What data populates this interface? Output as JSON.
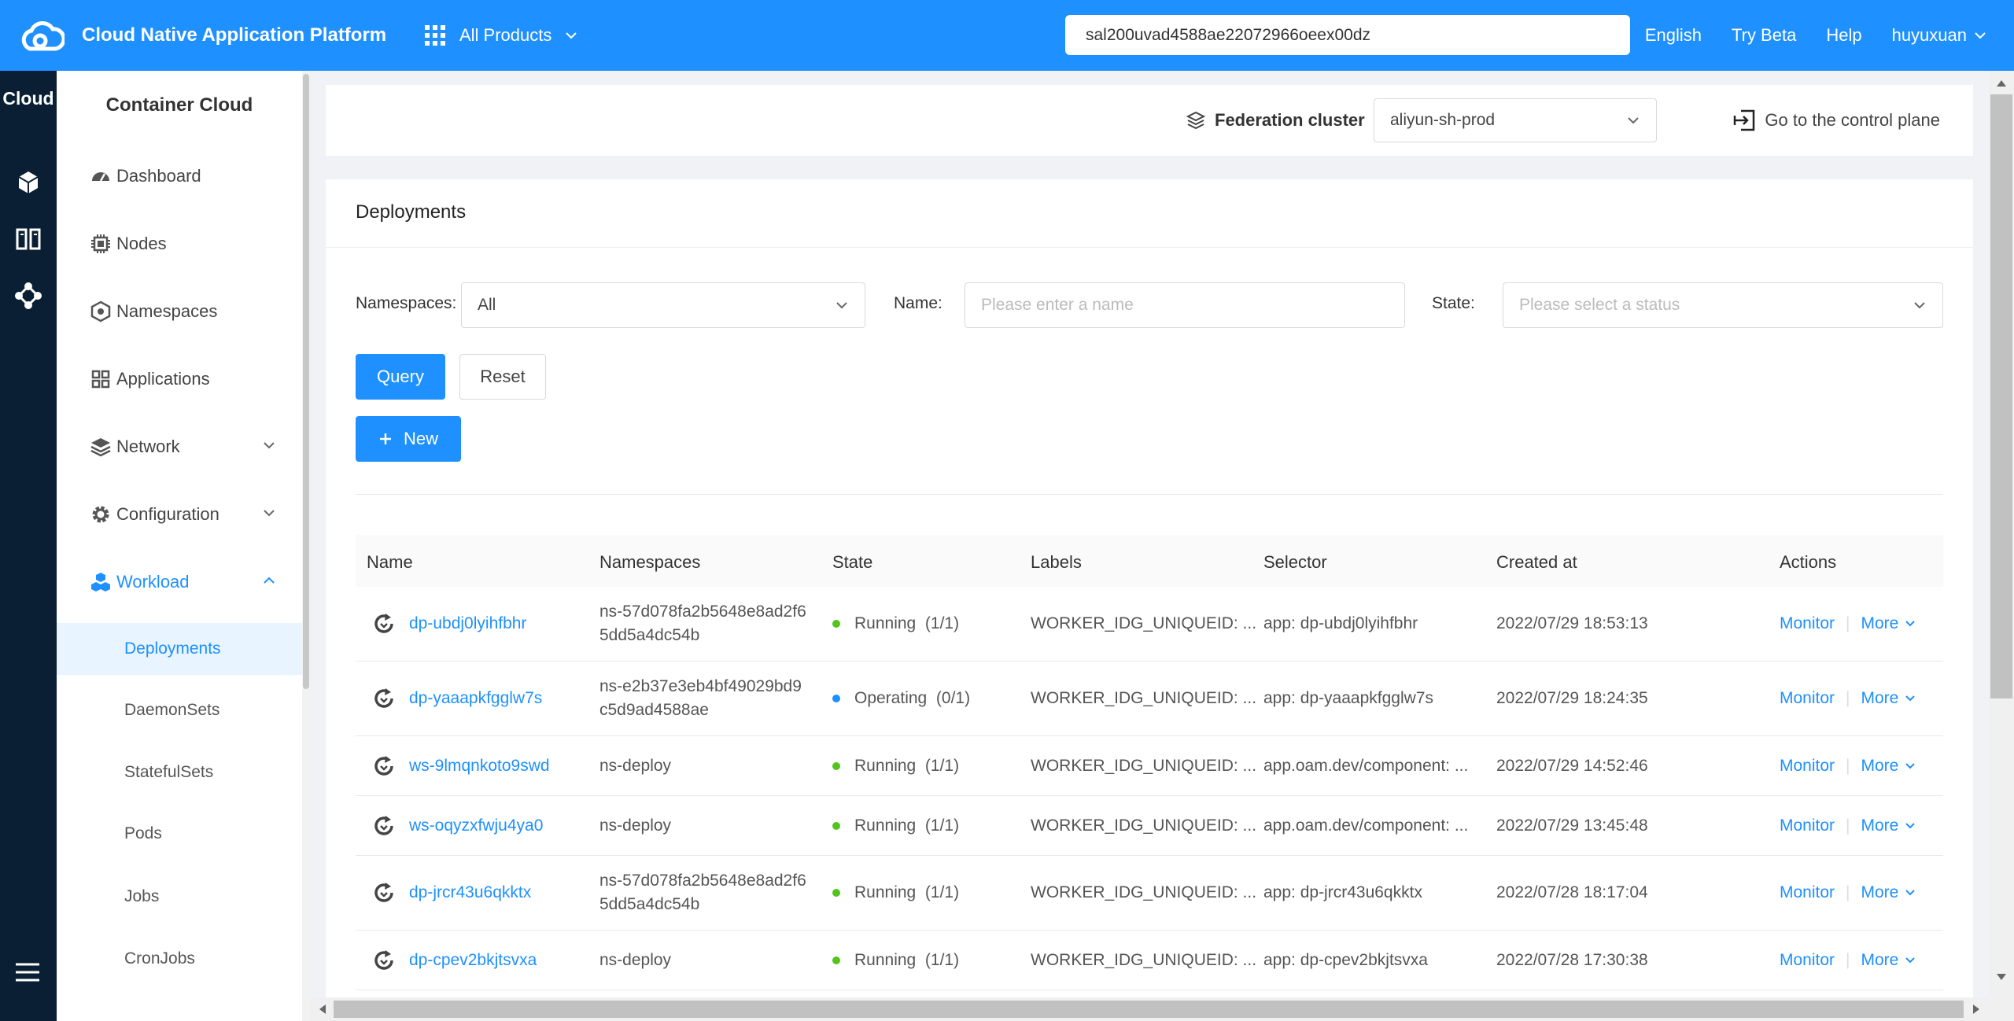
{
  "topbar": {
    "brand": "Cloud Native Application Platform",
    "products_label": "All Products",
    "search_value": "sal200uvad4588ae22072966oeex00dz",
    "language": "English",
    "try_beta": "Try Beta",
    "help": "Help",
    "user": "huyuxuan"
  },
  "rail": {
    "title": "Cloud"
  },
  "sidebar": {
    "title": "Container Cloud",
    "items": [
      {
        "label": "Dashboard",
        "icon": "dashboard-icon"
      },
      {
        "label": "Nodes",
        "icon": "chip-icon"
      },
      {
        "label": "Namespaces",
        "icon": "hexagon-icon"
      },
      {
        "label": "Applications",
        "icon": "apps-grid-icon"
      },
      {
        "label": "Network",
        "icon": "layers-icon"
      },
      {
        "label": "Configuration",
        "icon": "gear-icon"
      },
      {
        "label": "Workload",
        "icon": "cubes-icon"
      }
    ],
    "subitems": [
      "Deployments",
      "DaemonSets",
      "StatefulSets",
      "Pods",
      "Jobs",
      "CronJobs"
    ]
  },
  "federation": {
    "label": "Federation cluster",
    "selected": "aliyun-sh-prod",
    "goto_label": "Go to the control plane"
  },
  "deployments": {
    "title": "Deployments",
    "filters": {
      "namespaces_label": "Namespaces:",
      "namespaces_value": "All",
      "name_label": "Name:",
      "name_placeholder": "Please enter a name",
      "state_label": "State:",
      "state_placeholder": "Please select a status"
    },
    "query_label": "Query",
    "reset_label": "Reset",
    "new_label": "New",
    "columns": [
      "Name",
      "Namespaces",
      "State",
      "Labels",
      "Selector",
      "Created at",
      "Actions"
    ],
    "rows": [
      {
        "name": "dp-ubdj0lyihfbhr",
        "ns1": "ns-57d078fa2b5648e8ad2f6",
        "ns2": "5dd5a4dc54b",
        "state": "Running",
        "count": "(1/1)",
        "labels": "WORKER_IDG_UNIQUEID: ...",
        "selector": "app: dp-ubdj0lyihfbhr",
        "created": "2022/07/29 18:53:13",
        "monitor": "Monitor",
        "more": "More"
      },
      {
        "name": "dp-yaaapkfgglw7s",
        "ns1": "ns-e2b37e3eb4bf49029bd9",
        "ns2": "c5d9ad4588ae",
        "state": "Operating",
        "count": "(0/1)",
        "labels": "WORKER_IDG_UNIQUEID: ...",
        "selector": "app: dp-yaaapkfgglw7s",
        "created": "2022/07/29 18:24:35",
        "monitor": "Monitor",
        "more": "More"
      },
      {
        "name": "ws-9lmqnkoto9swd",
        "ns1": "ns-deploy",
        "ns2": "",
        "state": "Running",
        "count": "(1/1)",
        "labels": "WORKER_IDG_UNIQUEID: ...",
        "selector": "app.oam.dev/component: ...",
        "created": "2022/07/29 14:52:46",
        "monitor": "Monitor",
        "more": "More"
      },
      {
        "name": "ws-oqyzxfwju4ya0",
        "ns1": "ns-deploy",
        "ns2": "",
        "state": "Running",
        "count": "(1/1)",
        "labels": "WORKER_IDG_UNIQUEID: ...",
        "selector": "app.oam.dev/component: ...",
        "created": "2022/07/29 13:45:48",
        "monitor": "Monitor",
        "more": "More"
      },
      {
        "name": "dp-jrcr43u6qkktx",
        "ns1": "ns-57d078fa2b5648e8ad2f6",
        "ns2": "5dd5a4dc54b",
        "state": "Running",
        "count": "(1/1)",
        "labels": "WORKER_IDG_UNIQUEID: ...",
        "selector": "app: dp-jrcr43u6qkktx",
        "created": "2022/07/28 18:17:04",
        "monitor": "Monitor",
        "more": "More"
      },
      {
        "name": "dp-cpev2bkjtsvxa",
        "ns1": "ns-deploy",
        "ns2": "",
        "state": "Running",
        "count": "(1/1)",
        "labels": "WORKER_IDG_UNIQUEID: ...",
        "selector": "app: dp-cpev2bkjtsvxa",
        "created": "2022/07/28 17:30:38",
        "monitor": "Monitor",
        "more": "More"
      }
    ]
  },
  "colors": {
    "primary": "#1e90ff",
    "running": "#52c41a",
    "operating": "#1e90ff",
    "rail": "#0a1f33"
  }
}
